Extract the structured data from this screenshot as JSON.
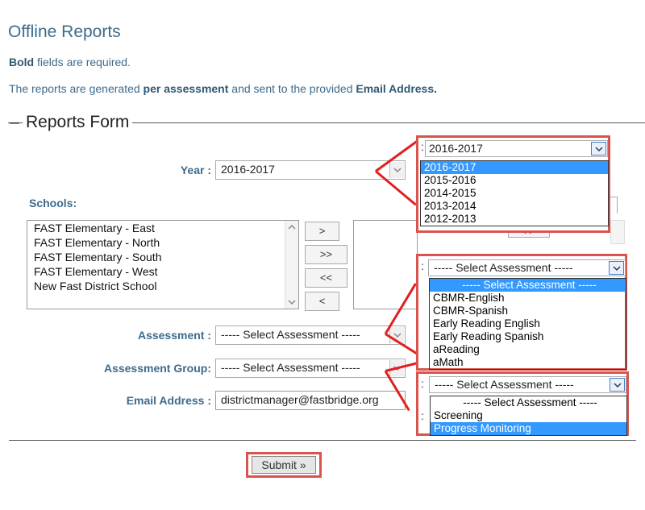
{
  "page": {
    "title": "Offline Reports",
    "required_note": {
      "bold": "Bold",
      "rest": " fields are required."
    },
    "generated_note": {
      "part1": "The reports are generated ",
      "bold1": "per assessment",
      "part2": " and sent to the provided ",
      "bold2": "Email Address."
    }
  },
  "form": {
    "legend": "Reports Form",
    "year_label": "Year :",
    "year_value": "2016-2017",
    "schools_label": "Schools:",
    "schools": [
      "FAST Elementary - East",
      "FAST Elementary - North",
      "FAST Elementary - South",
      "FAST Elementary - West",
      "New Fast District School"
    ],
    "move_buttons": [
      ">",
      ">>",
      "<<",
      "<"
    ],
    "selected_list_btn": ">>",
    "assessment_label": "Assessment :",
    "assessment_value": "----- Select Assessment -----",
    "group_label": "Assessment Group:",
    "group_value": "----- Select Assessment -----",
    "email_label": "Email Address :",
    "email_value": "districtmanager@fastbridge.org",
    "submit_label": "Submit »",
    "colon": ":"
  },
  "year_dropdown": {
    "value": "2016-2017",
    "options": [
      "2016-2017",
      "2015-2016",
      "2014-2015",
      "2013-2014",
      "2012-2013"
    ],
    "selected_index": 0
  },
  "assessment_dropdown": {
    "value": "----- Select Assessment -----",
    "options": [
      "----- Select Assessment -----",
      "CBMR-English",
      "CBMR-Spanish",
      "Early Reading English",
      "Early Reading Spanish",
      "aReading",
      "aMath"
    ],
    "selected_index": 0
  },
  "group_dropdown": {
    "value": "----- Select Assessment -----",
    "options": [
      "----- Select Assessment -----",
      "Screening",
      "Progress Monitoring"
    ],
    "selected_index": 2
  },
  "colors": {
    "accent_text": "#3d6b8c",
    "highlight_border": "#d9534f",
    "callout_line": "#e02020",
    "selection": "#3399ff"
  }
}
